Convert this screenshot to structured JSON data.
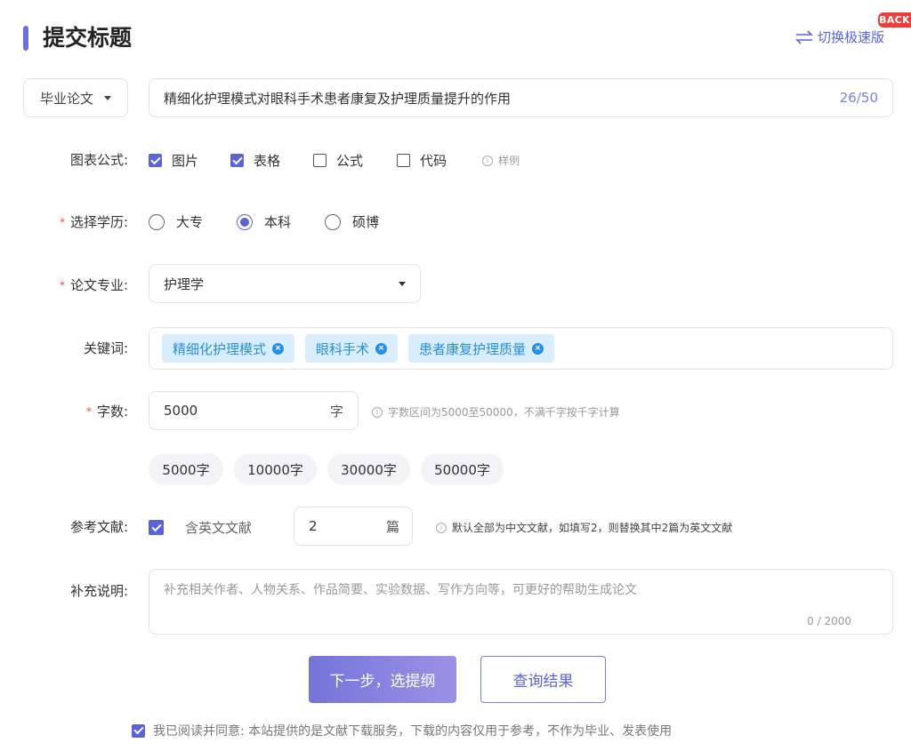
{
  "header": {
    "title": "提交标题",
    "switch_label": "切换极速版",
    "back_badge": "BACK"
  },
  "paper_type": {
    "selected": "毕业论文"
  },
  "title_input": {
    "value": "精细化护理模式对眼科手术患者康复及护理质量提升的作用",
    "count": "26/50"
  },
  "figures": {
    "label": "图表公式:",
    "options": [
      {
        "label": "图片",
        "checked": true
      },
      {
        "label": "表格",
        "checked": true
      },
      {
        "label": "公式",
        "checked": false
      },
      {
        "label": "代码",
        "checked": false
      }
    ],
    "hint": "样例"
  },
  "education": {
    "required_mark": "*",
    "label": "选择学历:",
    "options": [
      {
        "label": "大专",
        "selected": false
      },
      {
        "label": "本科",
        "selected": true
      },
      {
        "label": "硕博",
        "selected": false
      }
    ]
  },
  "major": {
    "required_mark": "*",
    "label": "论文专业:",
    "value": "护理学"
  },
  "keywords": {
    "label": "关键词:",
    "tags": [
      "精细化护理模式",
      "眼科手术",
      "患者康复护理质量"
    ]
  },
  "word_count": {
    "required_mark": "*",
    "label": "字数:",
    "value": "5000",
    "unit": "字",
    "hint": "字数区间为5000至50000，不满千字按千字计算",
    "presets": [
      "5000字",
      "10000字",
      "30000字",
      "50000字"
    ]
  },
  "references": {
    "label": "参考文献:",
    "english_checked": true,
    "english_label": "含英文文献",
    "count_value": "2",
    "count_unit": "篇",
    "hint": "默认全部为中文文献，如填写2，则替换其中2篇为英文文献"
  },
  "notes": {
    "label": "补充说明:",
    "placeholder": "补充相关作者、人物关系、作品简要、实验数据、写作方向等，可更好的帮助生成论文",
    "count": "0 / 2000"
  },
  "actions": {
    "next_label": "下一步，选提纲",
    "query_label": "查询结果"
  },
  "agreement": {
    "checked": true,
    "text": "我已阅读并同意: 本站提供的是文献下载服务，下载的内容仅用于参考，不作为毕业、发表使用"
  },
  "colors": {
    "accent": "#5b63d8",
    "tag_bg": "#d9eefc",
    "tag_text": "#2a8fd8",
    "required": "#e84848",
    "badge": "#ee3d3d"
  }
}
